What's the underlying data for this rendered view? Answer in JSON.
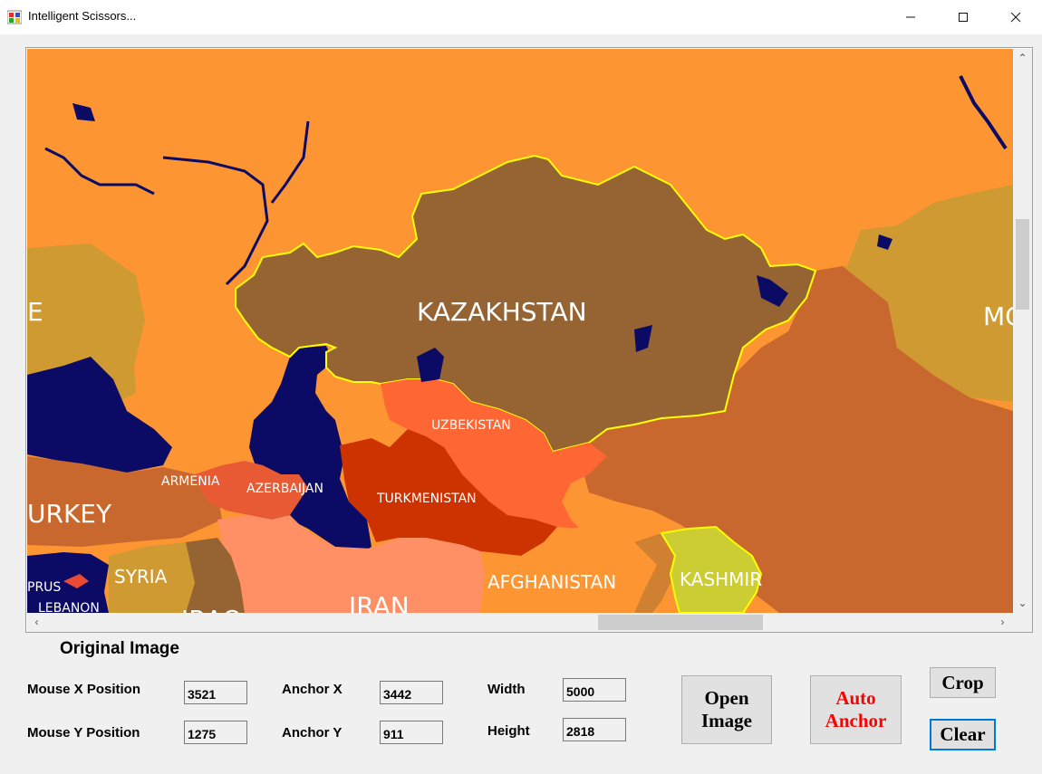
{
  "window": {
    "title": "Intelligent Scissors...",
    "minimize_icon": "minimize-icon",
    "maximize_icon": "maximize-icon",
    "close_icon": "close-icon"
  },
  "map": {
    "labels": {
      "kazakhstan": "KAZAKHSTAN",
      "uzbekistan": "UZBEKISTAN",
      "turkmenistan": "TURKMENISTAN",
      "armenia": "ARMENIA",
      "azerbaijan": "AZERBAIJAN",
      "turkey": "URKEY",
      "syria": "SYRIA",
      "cyprus": "PRUS",
      "lebanon": "LEBANON",
      "iraq": "IRAQ",
      "iran": "IRAN",
      "afghanistan": "AFGHANISTAN",
      "kashmir": "KASHMIR",
      "left_edge": "E",
      "mongolia": "MC"
    },
    "colors": {
      "land": "#fe9533",
      "water": "#0b0b66",
      "kazakhstan": "#956432",
      "selection": "#ffff00"
    }
  },
  "controls": {
    "heading": "Original Image",
    "mouse_x_label": "Mouse X Position",
    "mouse_x_value": "3521",
    "mouse_y_label": "Mouse Y Position",
    "mouse_y_value": "1275",
    "anchor_x_label": "Anchor X",
    "anchor_x_value": "3442",
    "anchor_y_label": "Anchor Y",
    "anchor_y_value": "911",
    "width_label": "Width",
    "width_value": "5000",
    "height_label": "Height",
    "height_value": "2818",
    "open_line1": "Open",
    "open_line2": "Image",
    "auto_line1": "Auto",
    "auto_line2": "Anchor",
    "crop": "Crop",
    "clear": "Clear",
    "accent_red": "#ff0000",
    "focus_border": "#0078d7"
  }
}
